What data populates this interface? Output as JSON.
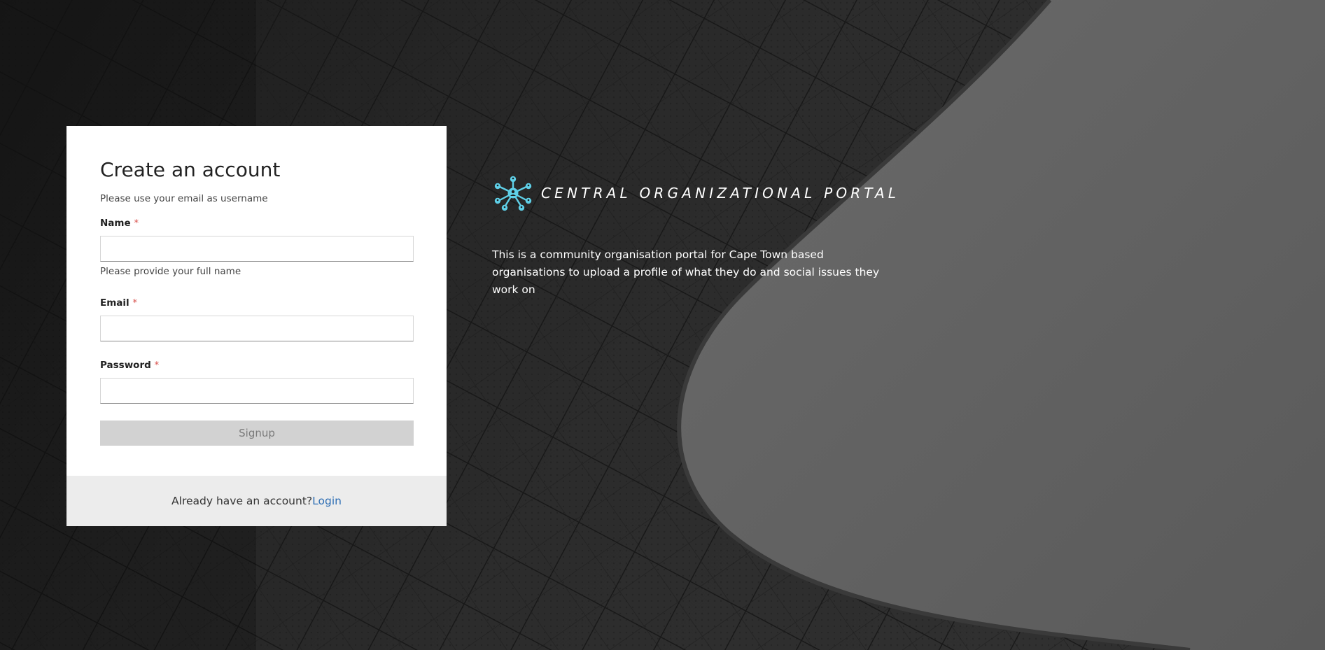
{
  "form": {
    "title": "Create an account",
    "subtitle": "Please use your email as username",
    "name": {
      "label": "Name",
      "required_mark": "*",
      "value": "",
      "helper": "Please provide your full name"
    },
    "email": {
      "label": "Email",
      "required_mark": "*",
      "value": ""
    },
    "password": {
      "label": "Password",
      "required_mark": "*",
      "value": ""
    },
    "submit_label": "Signup",
    "footer_text": "Already have an account?",
    "login_link": "Login"
  },
  "brand": {
    "name": "CENTRAL ORGANIZATIONAL PORTAL",
    "logo_icon": "network-people-icon",
    "logo_color": "#5fd0e8"
  },
  "description": "This is a community organisation portal for Cape Town based organisations to upload a profile of what they do and social issues they work on",
  "colors": {
    "link": "#2f6fb5",
    "required": "#d9534f",
    "button_disabled_bg": "#d2d2d2",
    "footer_bg": "#ececec"
  }
}
